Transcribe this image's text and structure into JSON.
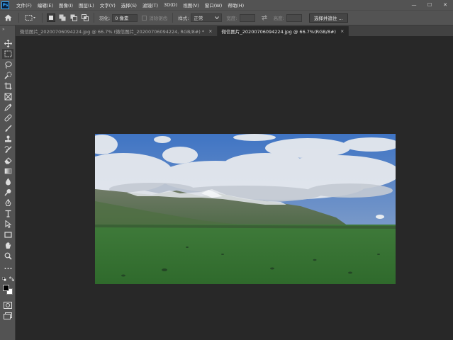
{
  "app": {
    "logo_text": "Ps"
  },
  "menu": [
    "文件(F)",
    "编辑(E)",
    "图像(I)",
    "图层(L)",
    "文字(Y)",
    "选择(S)",
    "滤镜(T)",
    "3D(D)",
    "视图(V)",
    "窗口(W)",
    "帮助(H)"
  ],
  "window_controls": {
    "minimize": "—",
    "maximize": "☐",
    "close": "✕"
  },
  "options": {
    "feather_label": "羽化:",
    "feather_value": "0 像素",
    "antialias_label": "消除锯齿",
    "style_label": "样式:",
    "style_value": "正常",
    "width_label": "宽度:",
    "height_label": "高度:",
    "select_mask_button": "选择并遮住 ..."
  },
  "tabs": [
    {
      "label": "微信图片_20200706094224.jpg @ 66.7% (微信图片_20200706094224, RGB/8#) *",
      "close": "×",
      "active": false
    },
    {
      "label": "微信图片_20200706094224.jpg @ 66.7%(RGB/8#)",
      "close": "×",
      "active": true
    }
  ],
  "toolbar": {
    "collapse": "»"
  }
}
